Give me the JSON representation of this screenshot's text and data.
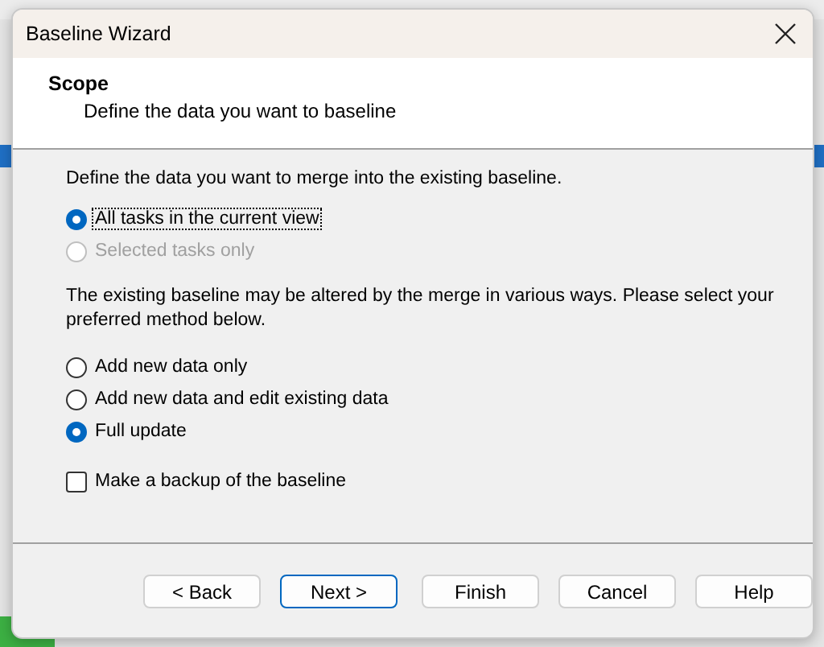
{
  "window": {
    "title": "Baseline Wizard"
  },
  "header": {
    "title": "Scope",
    "subtitle": "Define the data you want to baseline"
  },
  "scope_prompt": "Define the data you want to merge into the existing baseline.",
  "scope_options": [
    {
      "label": "All tasks in the current view",
      "selected": true,
      "disabled": false,
      "focused": true
    },
    {
      "label": "Selected tasks only",
      "selected": false,
      "disabled": true,
      "focused": false
    }
  ],
  "method_prompt": "The existing baseline may be altered by the merge in various ways. Please select your preferred method below.",
  "method_options": [
    {
      "label": "Add new data only",
      "selected": false
    },
    {
      "label": "Add new data and edit existing data",
      "selected": false
    },
    {
      "label": "Full update",
      "selected": true
    }
  ],
  "backup": {
    "label": "Make a backup of the baseline",
    "checked": false
  },
  "buttons": [
    {
      "label": "< Back",
      "default": false
    },
    {
      "label": "Next >",
      "default": true
    },
    {
      "label": "Finish",
      "default": false
    },
    {
      "label": "Cancel",
      "default": false
    },
    {
      "label": "Help",
      "default": false
    }
  ]
}
